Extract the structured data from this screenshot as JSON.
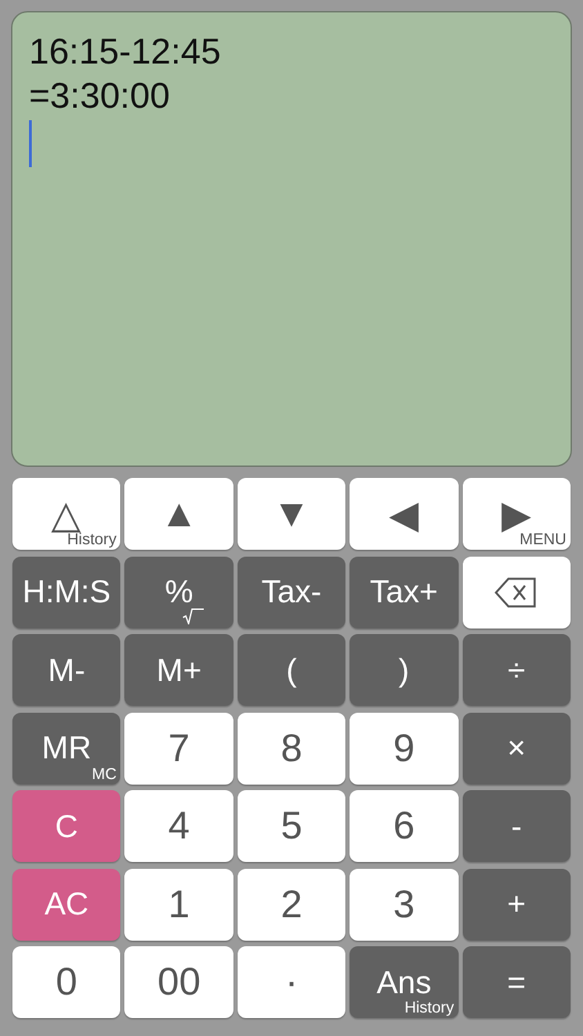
{
  "display": {
    "lines": [
      "16:15-12:45",
      "=3:30:00"
    ]
  },
  "keys": [
    {
      "label": "△",
      "sub": "History",
      "kind": "light"
    },
    {
      "label": "▲",
      "kind": "light"
    },
    {
      "label": "▼",
      "kind": "light"
    },
    {
      "label": "◀",
      "kind": "light"
    },
    {
      "label": "▶",
      "sub": "MENU",
      "kind": "light"
    },
    {
      "label": "H:M:S",
      "kind": "dark"
    },
    {
      "label": "%",
      "kind": "dark-root"
    },
    {
      "label": "Tax-",
      "kind": "dark"
    },
    {
      "label": "Tax+",
      "kind": "dark"
    },
    {
      "kind": "backspace"
    },
    {
      "label": "M-",
      "kind": "dark"
    },
    {
      "label": "M+",
      "kind": "dark"
    },
    {
      "label": "(",
      "kind": "dark"
    },
    {
      "label": ")",
      "kind": "dark"
    },
    {
      "label": "÷",
      "kind": "dark"
    },
    {
      "label": "MR",
      "sub": "MC",
      "kind": "dark"
    },
    {
      "label": "7",
      "kind": "light"
    },
    {
      "label": "8",
      "kind": "light"
    },
    {
      "label": "9",
      "kind": "light"
    },
    {
      "label": "×",
      "kind": "dark"
    },
    {
      "label": "C",
      "kind": "pink"
    },
    {
      "label": "4",
      "kind": "light"
    },
    {
      "label": "5",
      "kind": "light"
    },
    {
      "label": "6",
      "kind": "light"
    },
    {
      "label": "-",
      "kind": "dark"
    },
    {
      "label": "AC",
      "kind": "pink"
    },
    {
      "label": "1",
      "kind": "light"
    },
    {
      "label": "2",
      "kind": "light"
    },
    {
      "label": "3",
      "kind": "light"
    },
    {
      "label": "+",
      "kind": "dark"
    },
    {
      "label": "0",
      "kind": "light"
    },
    {
      "label": "00",
      "kind": "light"
    },
    {
      "label": "·",
      "kind": "light"
    },
    {
      "label": "Ans",
      "sub": "History",
      "kind": "dark"
    },
    {
      "label": "=",
      "kind": "dark"
    }
  ]
}
